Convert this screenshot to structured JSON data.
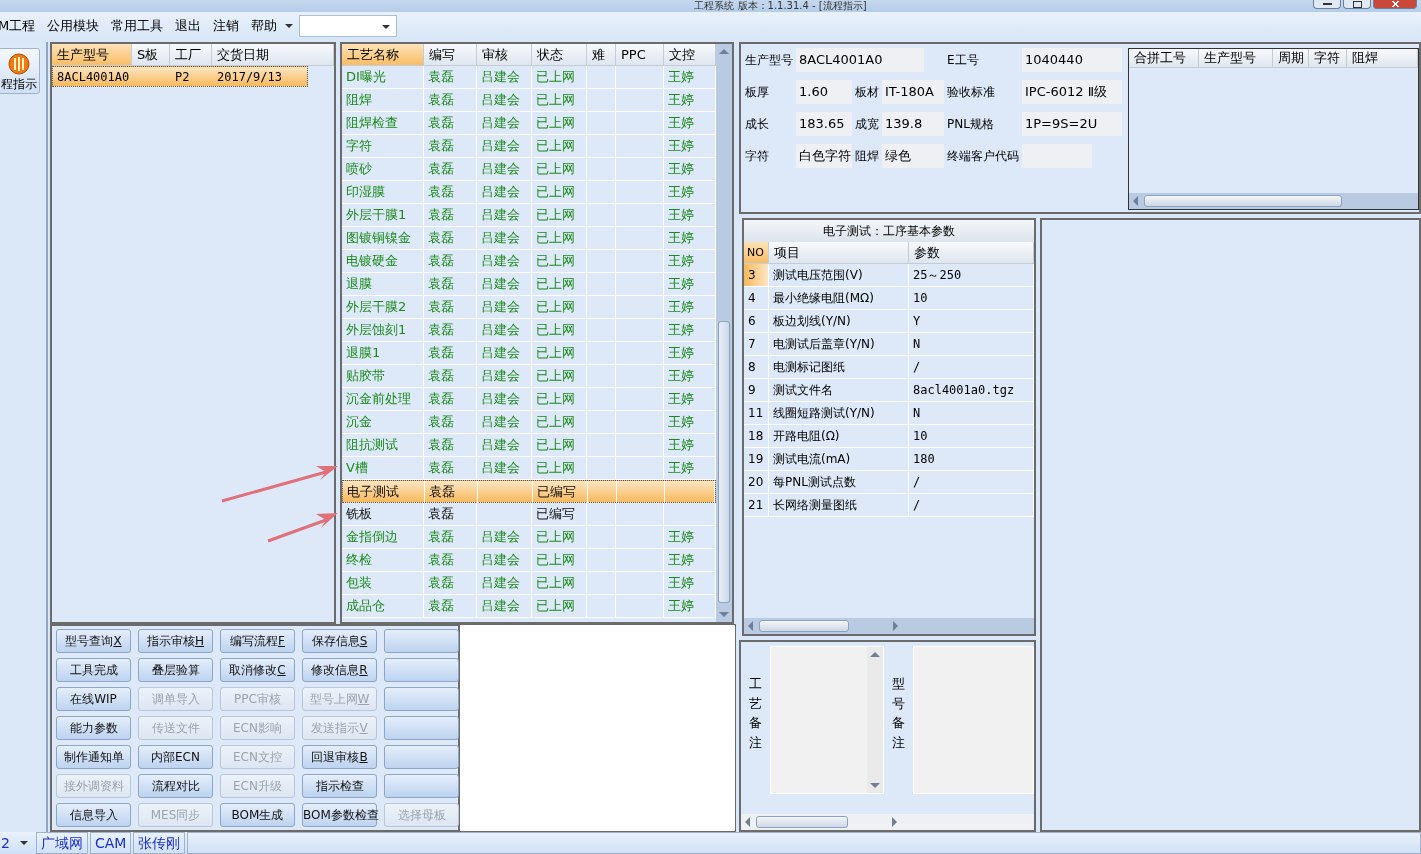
{
  "window": {
    "title": "工程系统   版本：1.1.31.4 - [流程指示]"
  },
  "menu": [
    "M工程",
    "公用模块",
    "常用工具",
    "退出",
    "注销",
    "帮助"
  ],
  "nav": {
    "label": "程指示"
  },
  "orders": {
    "columns": [
      "生产型号",
      "S板",
      "工厂",
      "交货日期"
    ],
    "rows": [
      {
        "model": "8ACL4001A0",
        "factory": "P2",
        "delivery_date": "2017/9/13",
        "selected": true
      }
    ]
  },
  "process": {
    "columns": [
      "工艺名称",
      "编写",
      "审核",
      "状态",
      "难",
      "PPC",
      "文控"
    ],
    "rows": [
      {
        "name": "DI曝光",
        "writer": "袁磊",
        "reviewer": "吕建会",
        "status": "已上网",
        "doc_control": "王婷",
        "released": true,
        "selected": false
      },
      {
        "name": "阻焊",
        "writer": "袁磊",
        "reviewer": "吕建会",
        "status": "已上网",
        "doc_control": "王婷",
        "released": true,
        "selected": false
      },
      {
        "name": "阻焊检查",
        "writer": "袁磊",
        "reviewer": "吕建会",
        "status": "已上网",
        "doc_control": "王婷",
        "released": true,
        "selected": false
      },
      {
        "name": "字符",
        "writer": "袁磊",
        "reviewer": "吕建会",
        "status": "已上网",
        "doc_control": "王婷",
        "released": true,
        "selected": false
      },
      {
        "name": "喷砂",
        "writer": "袁磊",
        "reviewer": "吕建会",
        "status": "已上网",
        "doc_control": "王婷",
        "released": true,
        "selected": false
      },
      {
        "name": "印湿膜",
        "writer": "袁磊",
        "reviewer": "吕建会",
        "status": "已上网",
        "doc_control": "王婷",
        "released": true,
        "selected": false
      },
      {
        "name": "外层干膜1",
        "writer": "袁磊",
        "reviewer": "吕建会",
        "status": "已上网",
        "doc_control": "王婷",
        "released": true,
        "selected": false
      },
      {
        "name": "图镀铜镍金",
        "writer": "袁磊",
        "reviewer": "吕建会",
        "status": "已上网",
        "doc_control": "王婷",
        "released": true,
        "selected": false
      },
      {
        "name": "电镀硬金",
        "writer": "袁磊",
        "reviewer": "吕建会",
        "status": "已上网",
        "doc_control": "王婷",
        "released": true,
        "selected": false
      },
      {
        "name": "退膜",
        "writer": "袁磊",
        "reviewer": "吕建会",
        "status": "已上网",
        "doc_control": "王婷",
        "released": true,
        "selected": false
      },
      {
        "name": "外层干膜2",
        "writer": "袁磊",
        "reviewer": "吕建会",
        "status": "已上网",
        "doc_control": "王婷",
        "released": true,
        "selected": false
      },
      {
        "name": "外层蚀刻1",
        "writer": "袁磊",
        "reviewer": "吕建会",
        "status": "已上网",
        "doc_control": "王婷",
        "released": true,
        "selected": false
      },
      {
        "name": "退膜1",
        "writer": "袁磊",
        "reviewer": "吕建会",
        "status": "已上网",
        "doc_control": "王婷",
        "released": true,
        "selected": false
      },
      {
        "name": "贴胶带",
        "writer": "袁磊",
        "reviewer": "吕建会",
        "status": "已上网",
        "doc_control": "王婷",
        "released": true,
        "selected": false
      },
      {
        "name": "沉金前处理",
        "writer": "袁磊",
        "reviewer": "吕建会",
        "status": "已上网",
        "doc_control": "王婷",
        "released": true,
        "selected": false
      },
      {
        "name": "沉金",
        "writer": "袁磊",
        "reviewer": "吕建会",
        "status": "已上网",
        "doc_control": "王婷",
        "released": true,
        "selected": false
      },
      {
        "name": "阻抗测试",
        "writer": "袁磊",
        "reviewer": "吕建会",
        "status": "已上网",
        "doc_control": "王婷",
        "released": true,
        "selected": false
      },
      {
        "name": "V槽",
        "writer": "袁磊",
        "reviewer": "吕建会",
        "status": "已上网",
        "doc_control": "王婷",
        "released": true,
        "selected": false
      },
      {
        "name": "电子测试",
        "writer": "袁磊",
        "status": "已编写",
        "released": false,
        "selected": true
      },
      {
        "name": "铣板",
        "writer": "袁磊",
        "status": "已编写",
        "released": false,
        "selected": false
      },
      {
        "name": "金指倒边",
        "writer": "袁磊",
        "reviewer": "吕建会",
        "status": "已上网",
        "doc_control": "王婷",
        "released": true,
        "selected": false
      },
      {
        "name": "终检",
        "writer": "袁磊",
        "reviewer": "吕建会",
        "status": "已上网",
        "doc_control": "王婷",
        "released": true,
        "selected": false
      },
      {
        "name": "包装",
        "writer": "袁磊",
        "reviewer": "吕建会",
        "status": "已上网",
        "doc_control": "王婷",
        "released": true,
        "selected": false
      },
      {
        "name": "成品仓",
        "writer": "袁磊",
        "reviewer": "吕建会",
        "status": "已上网",
        "doc_control": "王婷",
        "released": true,
        "selected": false
      }
    ]
  },
  "buttons": [
    {
      "label": "型号查询",
      "hotkey": "X",
      "disabled": false
    },
    {
      "label": "指示审核",
      "hotkey": "H",
      "disabled": false
    },
    {
      "label": "编写流程",
      "hotkey": "F",
      "disabled": false
    },
    {
      "label": "保存信息",
      "hotkey": "S",
      "disabled": false
    },
    {
      "disabled": false
    },
    {
      "label": "工具完成",
      "disabled": false
    },
    {
      "label": "叠层验算",
      "disabled": false
    },
    {
      "label": "取消修改",
      "hotkey": "C",
      "disabled": false
    },
    {
      "label": "修改信息",
      "hotkey": "R",
      "disabled": false
    },
    {
      "disabled": false
    },
    {
      "label": "在线WIP",
      "disabled": false
    },
    {
      "label": "调单导入",
      "disabled": true
    },
    {
      "label": "PPC审核",
      "disabled": true
    },
    {
      "label": "型号上网",
      "hotkey": "W",
      "disabled": true
    },
    {
      "disabled": false
    },
    {
      "label": "能力参数",
      "disabled": false
    },
    {
      "label": "传送文件",
      "disabled": true
    },
    {
      "label": "ECN影响",
      "disabled": true
    },
    {
      "label": "发送指示",
      "hotkey": "V",
      "disabled": true
    },
    {
      "disabled": false
    },
    {
      "label": "制作通知单",
      "disabled": false
    },
    {
      "label": "内部ECN",
      "disabled": false
    },
    {
      "label": "ECN文控",
      "disabled": true
    },
    {
      "label": "回退审核",
      "hotkey": "B",
      "disabled": false
    },
    {
      "disabled": false
    },
    {
      "label": "接外调资料",
      "disabled": true
    },
    {
      "label": "流程对比",
      "disabled": false
    },
    {
      "label": "ECN升级",
      "disabled": true
    },
    {
      "label": "指示检查",
      "disabled": false
    },
    {
      "disabled": false
    },
    {
      "label": "信息导入",
      "disabled": false
    },
    {
      "label": "MES同步",
      "disabled": true
    },
    {
      "label": "BOM生成",
      "disabled": false
    },
    {
      "label": "BOM参数检查",
      "disabled": false
    },
    {
      "label": "选择母板",
      "disabled": true
    }
  ],
  "info": {
    "fields": [
      {
        "label": "生产型号",
        "value": "8ACL4001A0"
      },
      {
        "label": "E工号",
        "value": "1040440"
      },
      {
        "label": "板厚",
        "value": "1.60"
      },
      {
        "label": "板材",
        "value": "IT-180A"
      },
      {
        "label": "验收标准",
        "value": "IPC-6012 Ⅱ级"
      },
      {
        "label": "成长",
        "value": "183.65"
      },
      {
        "label": "成宽",
        "value": "139.8"
      },
      {
        "label": "PNL规格",
        "value": "1P=9S=2U"
      },
      {
        "label": "字符",
        "value": "白色字符"
      },
      {
        "label": "阻焊",
        "value": "绿色"
      },
      {
        "label": "终端客户代码"
      }
    ]
  },
  "merge_table": {
    "columns": [
      "合拼工号",
      "生产型号",
      "周期",
      "字符",
      "阻焊"
    ]
  },
  "params": {
    "title": "电子测试：工序基本参数",
    "columns": [
      "NO",
      "项目",
      "参数"
    ],
    "rows": [
      {
        "no": "3",
        "item": "测试电压范围(V)",
        "value": "25～250",
        "selected": true
      },
      {
        "no": "4",
        "item": "最小绝缘电阻(MΩ)",
        "value": "10",
        "selected": false
      },
      {
        "no": "6",
        "item": "板边划线(Y/N)",
        "value": "Y",
        "selected": false
      },
      {
        "no": "7",
        "item": "电测试后盖章(Y/N)",
        "value": "N",
        "selected": false
      },
      {
        "no": "8",
        "item": "电测标记图纸",
        "value": "/",
        "selected": false
      },
      {
        "no": "9",
        "item": "测试文件名",
        "value": "8acl4001a0.tgz",
        "selected": false
      },
      {
        "no": "11",
        "item": "线圈短路测试(Y/N)",
        "value": "N",
        "selected": false
      },
      {
        "no": "18",
        "item": "开路电阻(Ω)",
        "value": "10",
        "selected": false
      },
      {
        "no": "19",
        "item": "测试电流(mA)",
        "value": "180",
        "selected": false
      },
      {
        "no": "20",
        "item": "每PNL测试点数",
        "value": "/",
        "selected": false
      },
      {
        "no": "21",
        "item": "长网络测量图纸",
        "value": "/",
        "selected": false
      }
    ]
  },
  "memos": [
    {
      "label": "工艺备注"
    },
    {
      "label": "型号备注"
    }
  ],
  "status_bar": {
    "page": "2",
    "items": [
      "广域网",
      "CAM",
      "张传刚"
    ]
  }
}
